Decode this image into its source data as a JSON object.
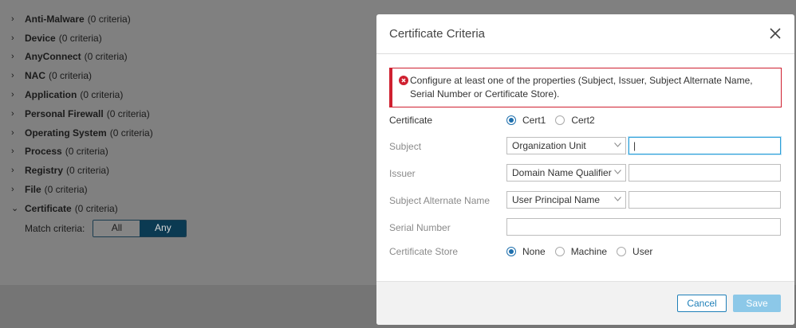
{
  "criteria": [
    {
      "name": "Anti-Malware",
      "count": "(0 criteria)",
      "chevron": "›"
    },
    {
      "name": "Device",
      "count": "(0 criteria)",
      "chevron": "›"
    },
    {
      "name": "AnyConnect",
      "count": "(0 criteria)",
      "chevron": "›"
    },
    {
      "name": "NAC",
      "count": "(0 criteria)",
      "chevron": "›"
    },
    {
      "name": "Application",
      "count": "(0 criteria)",
      "chevron": "›"
    },
    {
      "name": "Personal Firewall",
      "count": "(0 criteria)",
      "chevron": "›"
    },
    {
      "name": "Operating System",
      "count": "(0 criteria)",
      "chevron": "›"
    },
    {
      "name": "Process",
      "count": "(0 criteria)",
      "chevron": "›"
    },
    {
      "name": "Registry",
      "count": "(0 criteria)",
      "chevron": "›"
    },
    {
      "name": "File",
      "count": "(0 criteria)",
      "chevron": "›"
    },
    {
      "name": "Certificate",
      "count": "(0 criteria)",
      "chevron": "⌄"
    }
  ],
  "match": {
    "label": "Match criteria:",
    "all": "All",
    "any": "Any",
    "selected": "Any"
  },
  "modal": {
    "title": "Certificate Criteria",
    "alert": "Configure at least one of the properties (Subject, Issuer, Subject Alternate Name, Serial Number or Certificate Store).",
    "certificate": {
      "label": "Certificate",
      "options": [
        "Cert1",
        "Cert2"
      ],
      "selected": "Cert1"
    },
    "subject": {
      "label": "Subject",
      "select": "Organization Unit",
      "value": "|"
    },
    "issuer": {
      "label": "Issuer",
      "select": "Domain Name Qualifier",
      "value": ""
    },
    "san": {
      "label": "Subject Alternate Name",
      "select": "User Principal Name",
      "value": ""
    },
    "serial": {
      "label": "Serial Number",
      "value": ""
    },
    "store": {
      "label": "Certificate Store",
      "options": [
        "None",
        "Machine",
        "User"
      ],
      "selected": "None"
    },
    "cancel": "Cancel",
    "save": "Save"
  },
  "colors": {
    "accent": "#1e6fad",
    "error": "#cf2030",
    "save_disabled": "#8cc8e8",
    "segment_selected": "#0b3a52"
  }
}
